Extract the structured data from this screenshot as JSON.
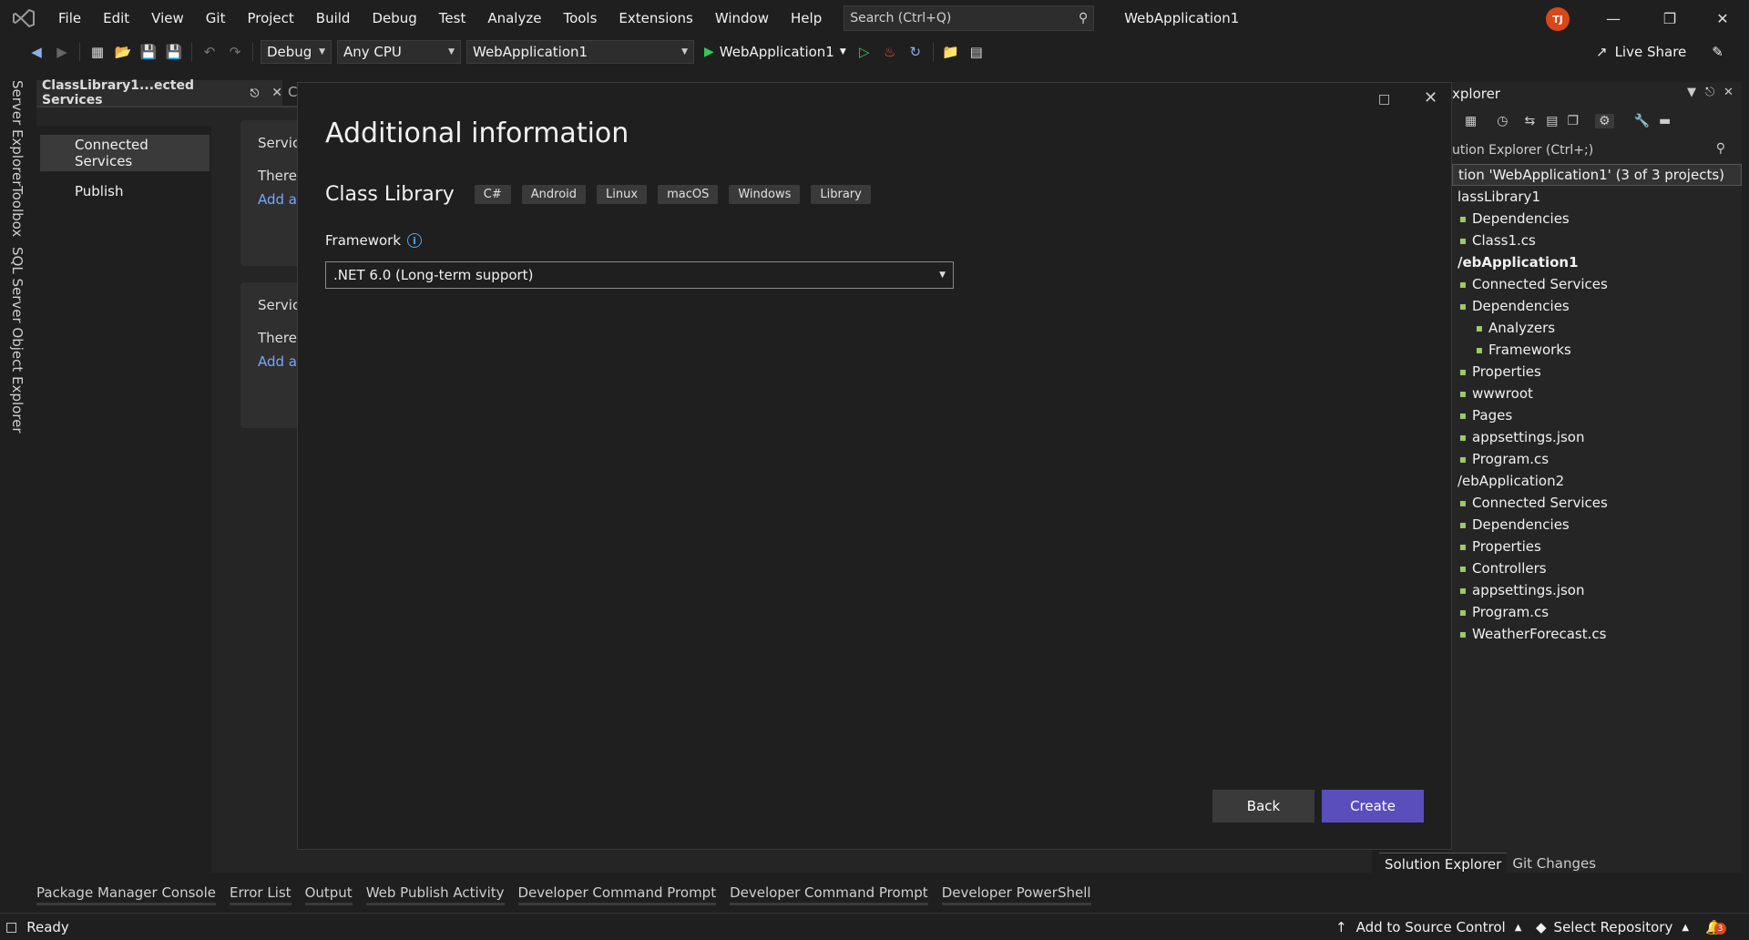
{
  "app": {
    "window_title": "WebApplication1",
    "user_initials": "TJ"
  },
  "menu": [
    "File",
    "Edit",
    "View",
    "Git",
    "Project",
    "Build",
    "Debug",
    "Test",
    "Analyze",
    "Tools",
    "Extensions",
    "Window",
    "Help"
  ],
  "search": {
    "placeholder": "Search (Ctrl+Q)"
  },
  "toolbar": {
    "config": "Debug",
    "platform": "Any CPU",
    "startup_project": "WebApplication1",
    "run_target": "WebApplication1",
    "live_share": "Live Share"
  },
  "left_vertical_tabs": [
    "Server Explorer",
    "Toolbox",
    "SQL Server Object Explorer"
  ],
  "document": {
    "tab_title": "ClassLibrary1...ected Services",
    "second_tab_title": "C",
    "nav": [
      "Connected Services",
      "Publish"
    ],
    "cards": [
      {
        "title": "Service",
        "text": "There",
        "link": "Add a"
      },
      {
        "title": "Service",
        "text": "There",
        "link": "Add a"
      }
    ]
  },
  "dialog": {
    "title": "Additional information",
    "template_name": "Class Library",
    "tags": [
      "C#",
      "Android",
      "Linux",
      "macOS",
      "Windows",
      "Library"
    ],
    "framework_label": "Framework",
    "framework_value": ".NET 6.0 (Long-term support)",
    "back_label": "Back",
    "create_label": "Create",
    "accent_color": "#5a4dbc"
  },
  "solution_explorer": {
    "title": "xplorer",
    "search_placeholder": "ution Explorer (Ctrl+;)",
    "tree": [
      {
        "label": "tion 'WebApplication1' (3 of 3 projects)",
        "indent": 0,
        "selected": true
      },
      {
        "label": "lassLibrary1",
        "indent": 0
      },
      {
        "label": "Dependencies",
        "indent": 1
      },
      {
        "label": "Class1.cs",
        "indent": 1
      },
      {
        "label": "/ebApplication1",
        "indent": 0,
        "bold": true
      },
      {
        "label": "Connected Services",
        "indent": 1
      },
      {
        "label": "Dependencies",
        "indent": 1
      },
      {
        "label": "Analyzers",
        "indent": 2
      },
      {
        "label": "Frameworks",
        "indent": 2
      },
      {
        "label": "Properties",
        "indent": 1
      },
      {
        "label": "wwwroot",
        "indent": 1
      },
      {
        "label": "Pages",
        "indent": 1
      },
      {
        "label": "appsettings.json",
        "indent": 1
      },
      {
        "label": "Program.cs",
        "indent": 1
      },
      {
        "label": "/ebApplication2",
        "indent": 0
      },
      {
        "label": "Connected Services",
        "indent": 1
      },
      {
        "label": "Dependencies",
        "indent": 1
      },
      {
        "label": "Properties",
        "indent": 1
      },
      {
        "label": "Controllers",
        "indent": 1
      },
      {
        "label": "appsettings.json",
        "indent": 1
      },
      {
        "label": "Program.cs",
        "indent": 1
      },
      {
        "label": "WeatherForecast.cs",
        "indent": 1
      }
    ],
    "bottom_tabs": [
      "Solution Explorer",
      "Git Changes"
    ]
  },
  "bottom_tool_tabs": [
    "Package Manager Console",
    "Error List",
    "Output",
    "Web Publish Activity",
    "Developer Command Prompt",
    "Developer Command Prompt",
    "Developer PowerShell"
  ],
  "status": {
    "ready": "Ready",
    "source_control": "Add to Source Control",
    "repository": "Select Repository",
    "notifications": "3"
  }
}
